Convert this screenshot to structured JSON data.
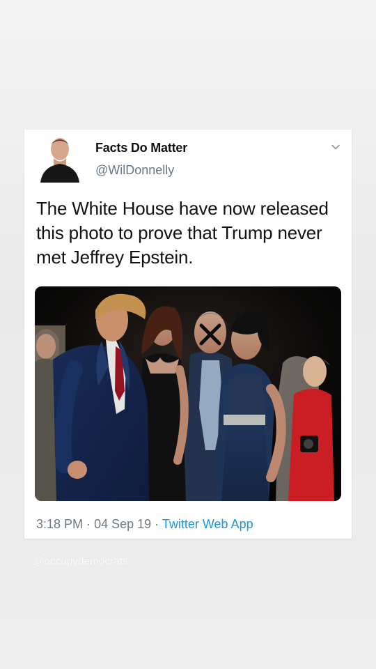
{
  "tweet": {
    "author_name": "Facts Do Matter",
    "author_handle": "@WilDonnelly",
    "text": "The White House have now released this photo to prove that Trump never met Jeffrey Epstein.",
    "time": "3:18 PM",
    "date": "04 Sep 19",
    "source": "Twitter Web App",
    "separator": "·"
  },
  "watermark": "@occupydemocrats",
  "icons": {
    "chevron": "chevron-down-icon",
    "avatar": "avatar"
  },
  "colors": {
    "background": "#ececec",
    "card": "#ffffff",
    "text": "#111111",
    "secondary_text": "#657786",
    "link": "#1b95e0"
  }
}
